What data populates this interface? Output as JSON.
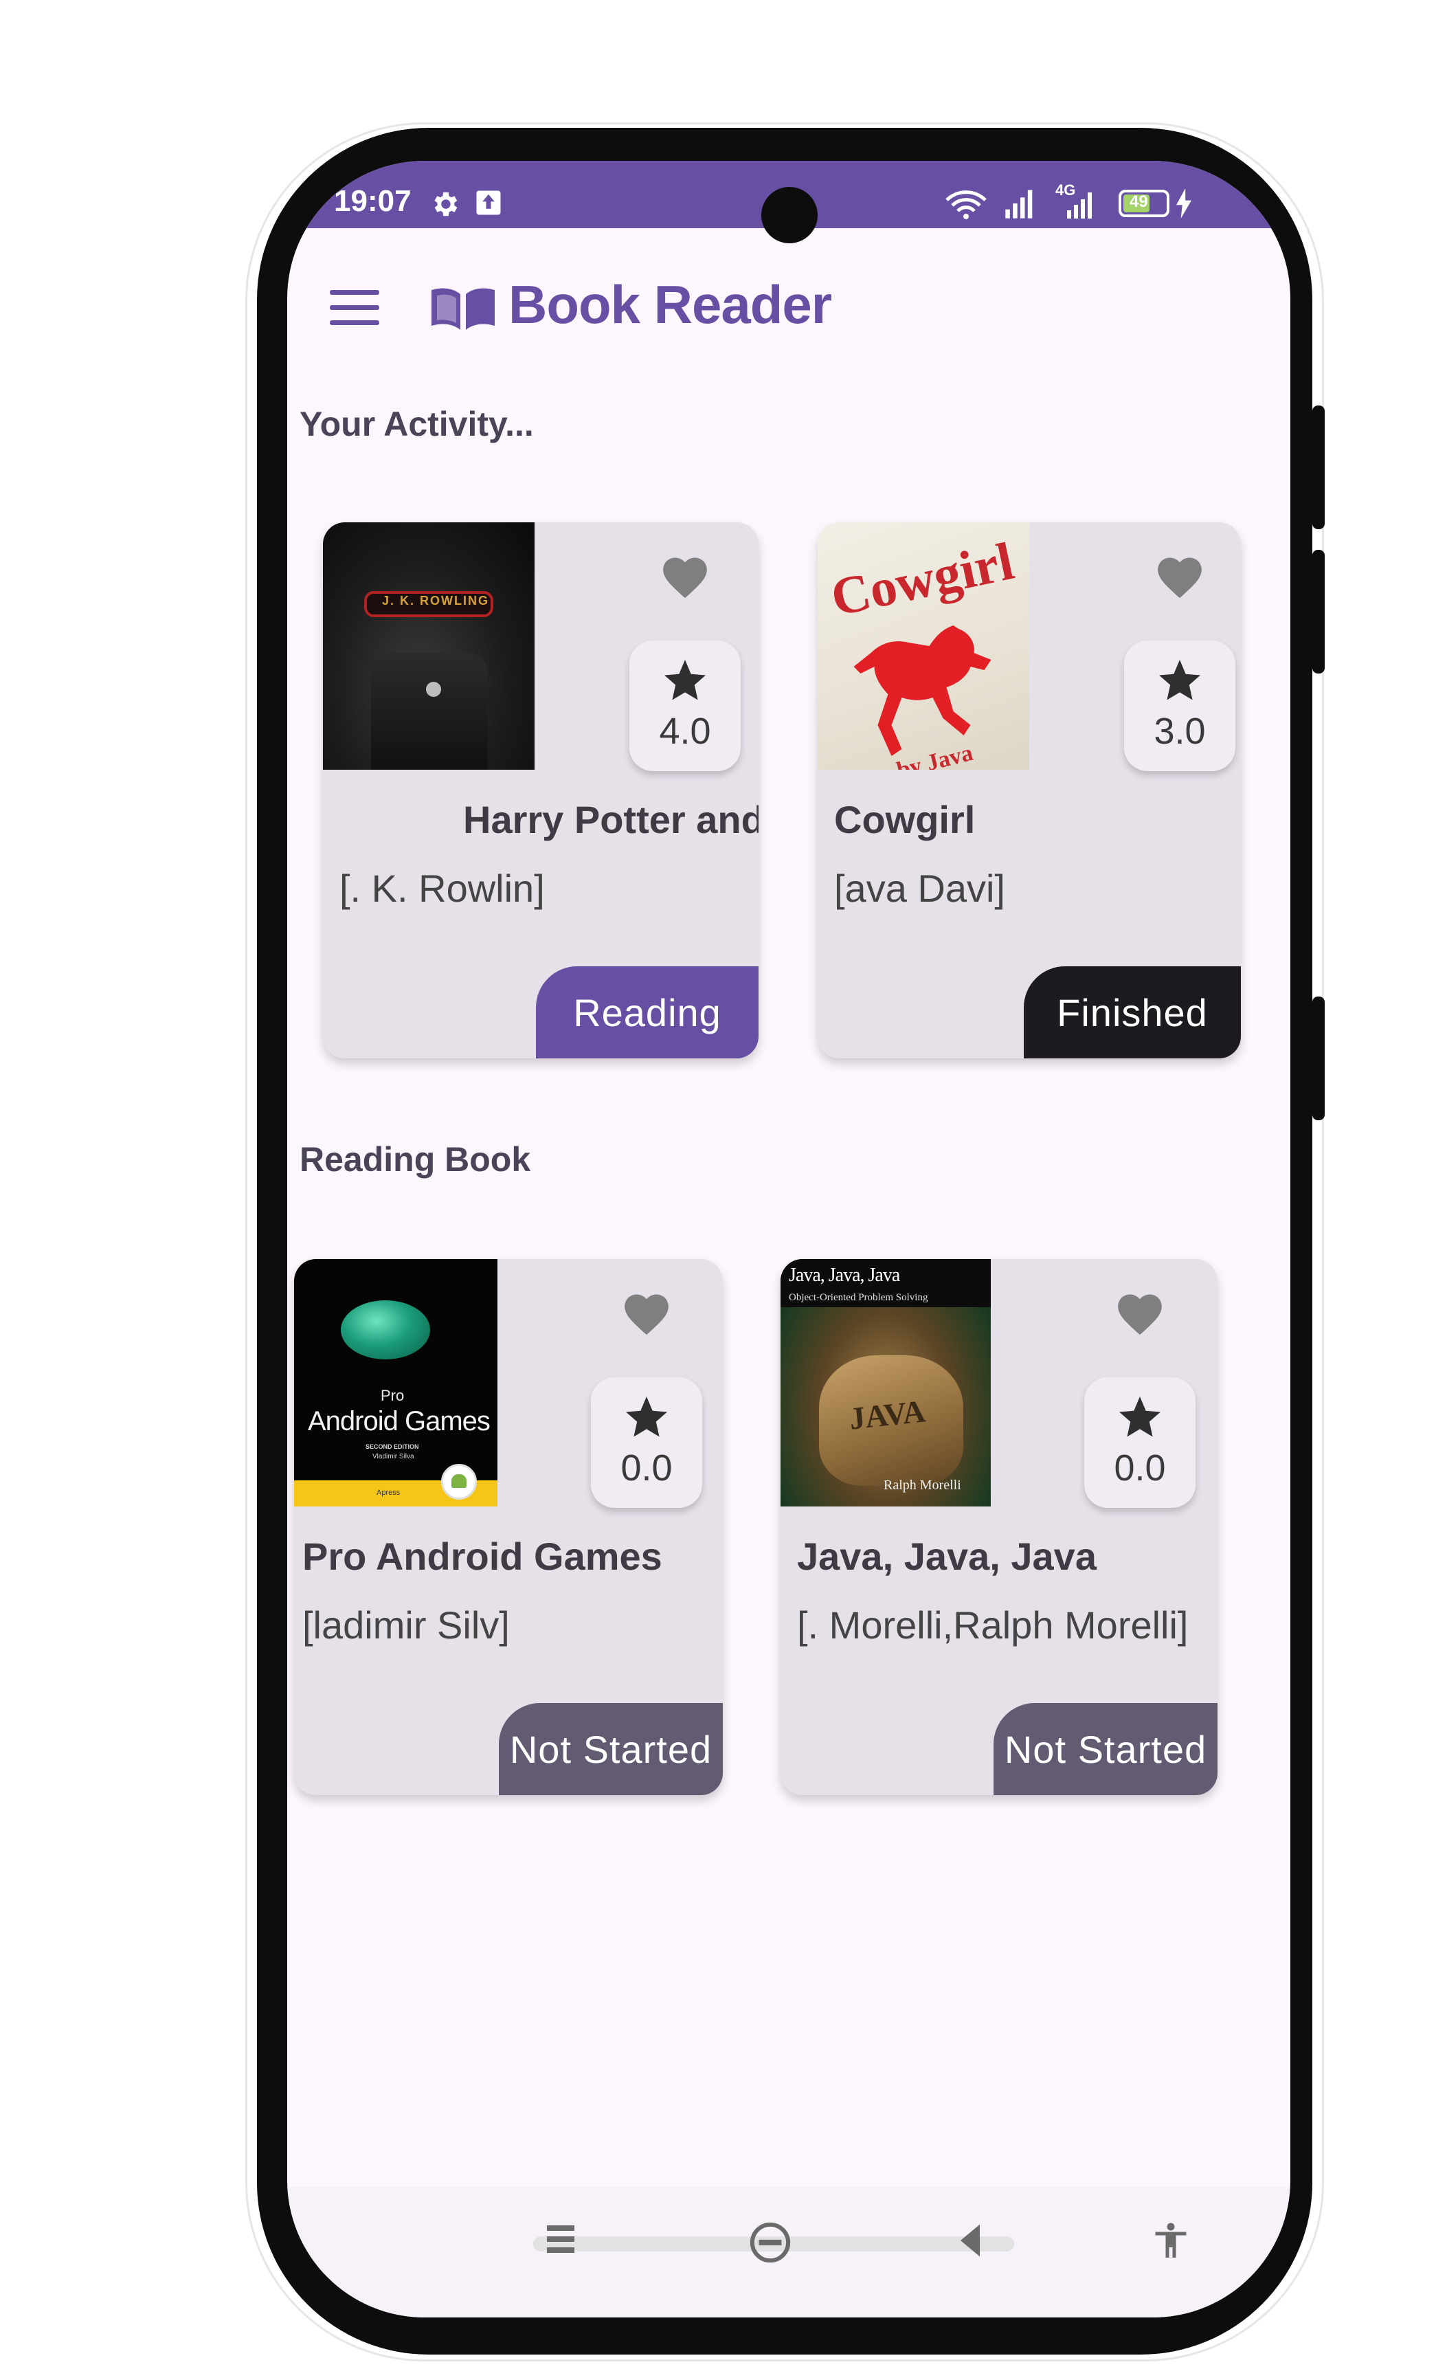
{
  "status_bar": {
    "time": "19:07",
    "battery": "49",
    "network": "4G"
  },
  "app_bar": {
    "title": "Book Reader",
    "menu_icon": "hamburger-menu-icon",
    "logo_icon": "open-book-icon"
  },
  "sections": {
    "activity_title": "Your Activity...",
    "reading_title": "Reading Book"
  },
  "activity_books": [
    {
      "title": "Harry Potter and",
      "author": "[. K. Rowlin]",
      "rating": "4.0",
      "status": "Reading",
      "cover_author_text": "J. K. ROWLING"
    },
    {
      "title": "Cowgirl",
      "author": "[ava Davi]",
      "rating": "3.0",
      "status": "Finished",
      "cover_title_text": "Cowgirl",
      "cover_author_text": "by Java Davis"
    }
  ],
  "reading_books": [
    {
      "title": "Pro Android Games",
      "author": "[ladimir Silv]",
      "rating": "0.0",
      "status": "Not Started",
      "cover_pro": "Pro",
      "cover_title": "Android Games",
      "cover_edition": "SECOND EDITION",
      "cover_author": "Vladimir Silva",
      "cover_publisher": "Apress"
    },
    {
      "title": "Java, Java, Java",
      "author": "[. Morelli,Ralph Morelli]",
      "rating": "0.0",
      "status": "Not Started",
      "cover_title": "Java, Java, Java",
      "cover_subtitle": "Object-Oriented Problem Solving",
      "cover_bag": "JAVA",
      "cover_author": "Ralph Morelli"
    }
  ],
  "fab": {
    "icon": "plus-icon"
  },
  "colors": {
    "primary": "#6750a4",
    "card": "#e6e0e9",
    "finished": "#1d1b20",
    "not_started": "#625b71"
  }
}
